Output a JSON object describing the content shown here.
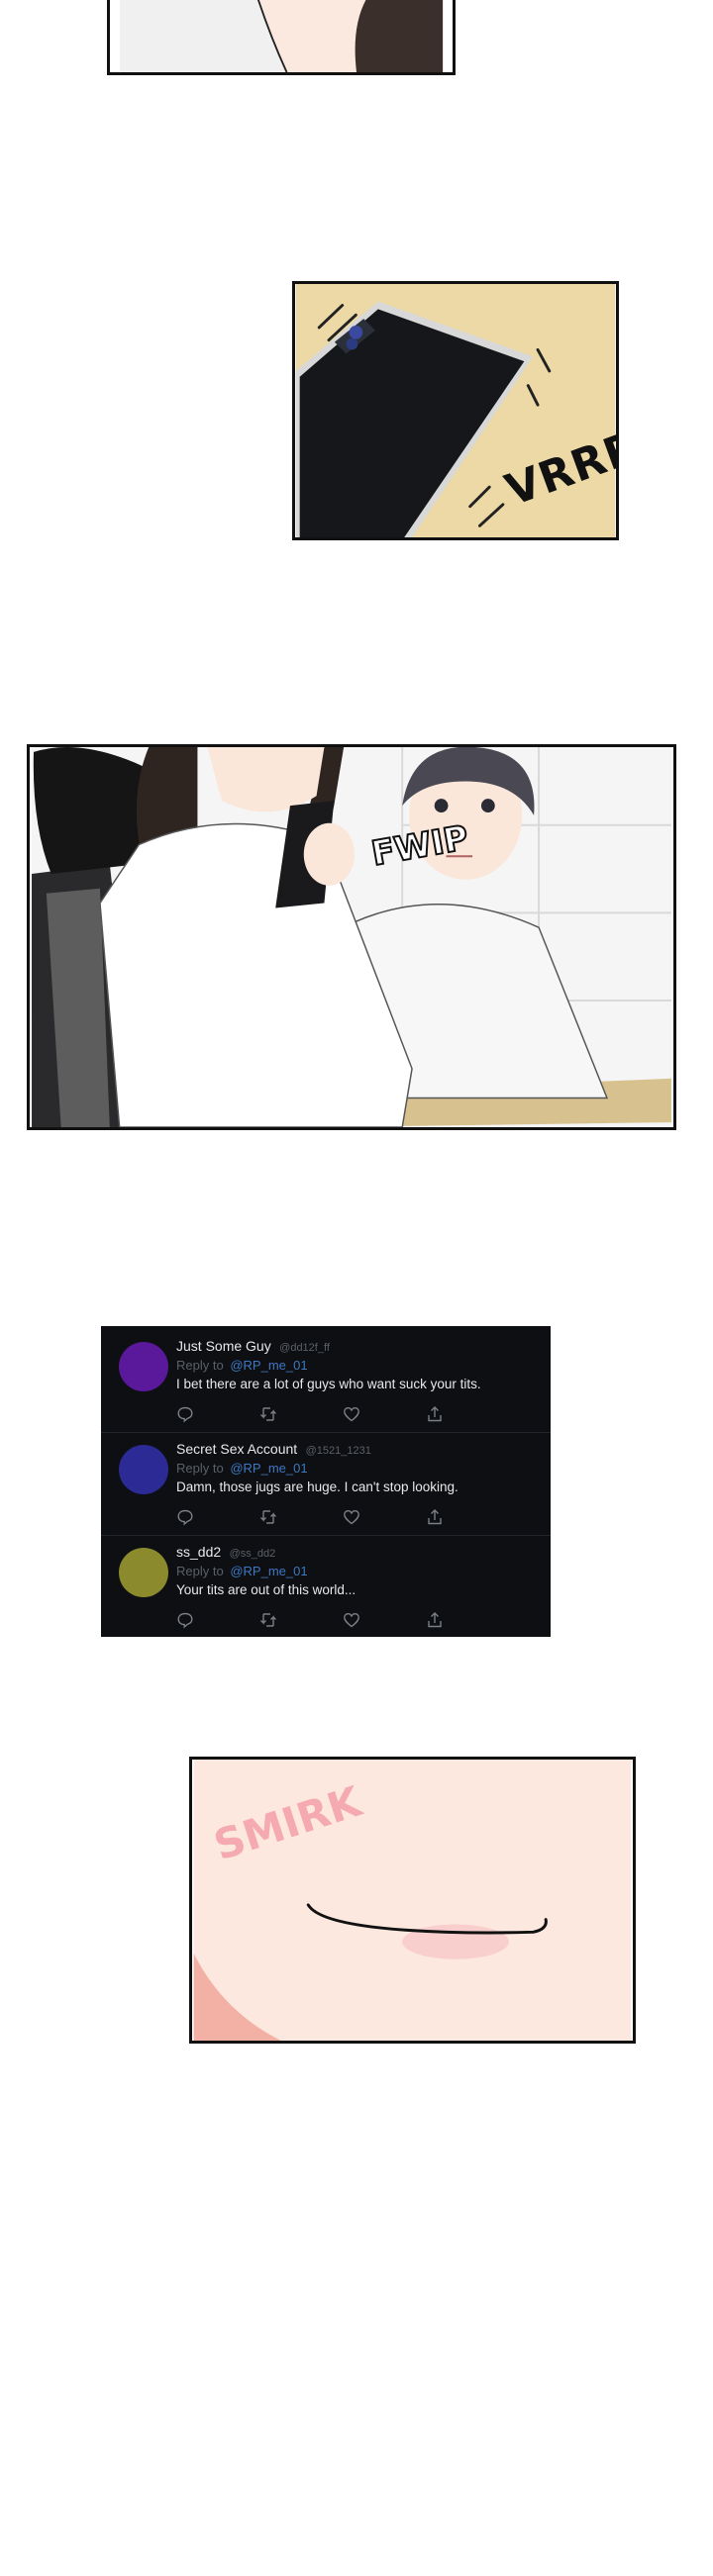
{
  "sfx": {
    "vibrate": "VRRR-",
    "fwip": "FWIP",
    "smirk": "SMIRK"
  },
  "tweets": [
    {
      "name": "Just Some Guy",
      "handle": "@dd12f_ff",
      "reply_label": "Reply to",
      "mention": "@RP_me_01",
      "text": "I bet there are a lot of guys who want suck your tits.",
      "avatar_color": "#5a189a"
    },
    {
      "name": "Secret Sex Account",
      "handle": "@1521_1231",
      "reply_label": "Reply to",
      "mention": "@RP_me_01",
      "text": "Damn, those jugs are huge. I can't stop looking.",
      "avatar_color": "#2c2a94"
    },
    {
      "name": "ss_dd2",
      "handle": "@ss_dd2",
      "reply_label": "Reply to",
      "mention": "@RP_me_01",
      "text": "Your tits are out of this world...",
      "avatar_color": "#8b8a2c"
    }
  ],
  "icons": [
    "comment-icon",
    "retweet-icon",
    "like-icon",
    "share-icon"
  ]
}
